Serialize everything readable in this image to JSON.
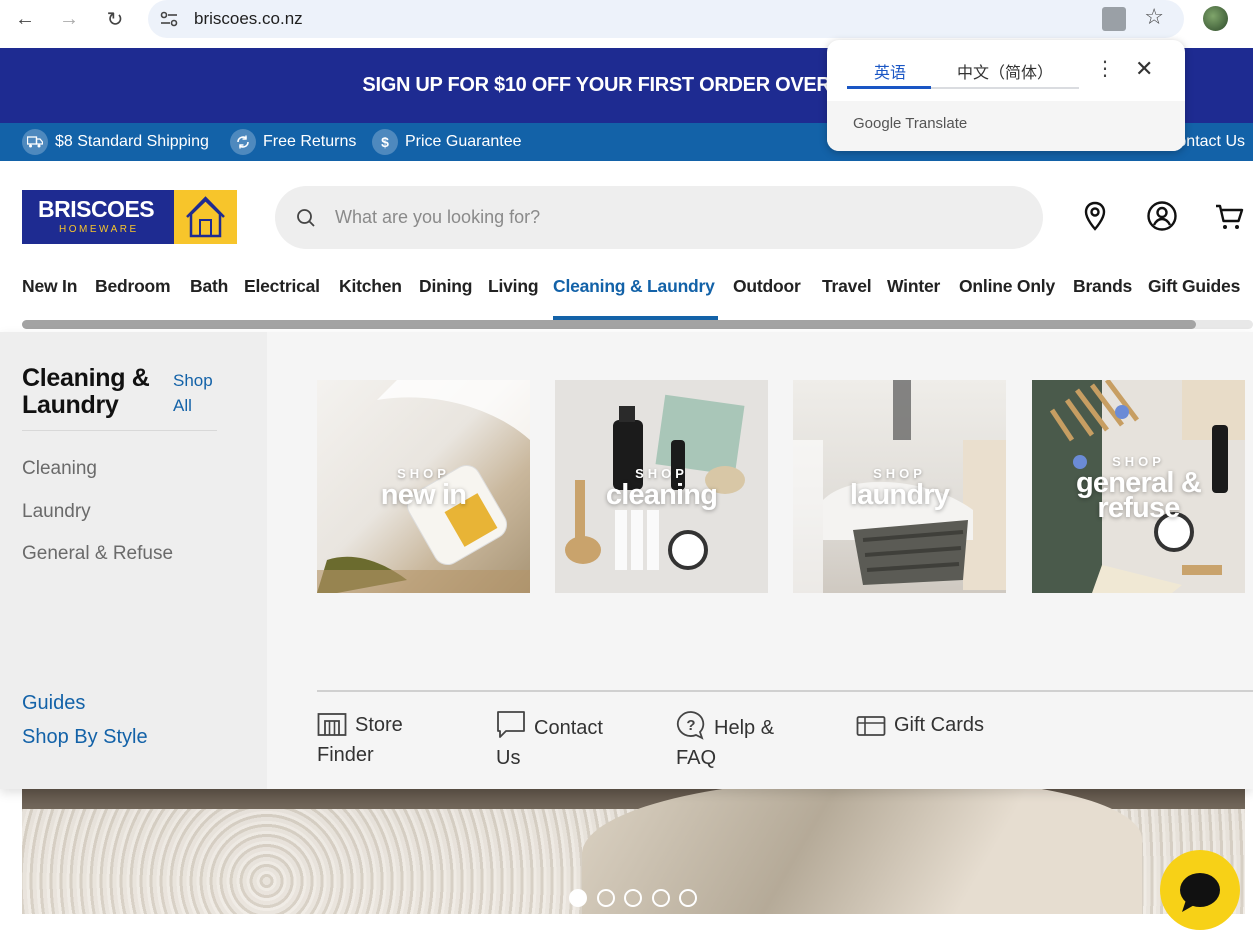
{
  "browser": {
    "url": "briscoes.co.nz"
  },
  "translate_popup": {
    "tab_source": "英语",
    "tab_target": "中文（简体）",
    "more_label": "⋮",
    "close_label": "✕",
    "brand": "Google Translate"
  },
  "promo": {
    "text": "SIGN UP FOR $10 OFF YOUR FIRST ORDER OVER"
  },
  "usp": {
    "shipping": "$8 Standard Shipping",
    "returns": "Free Returns",
    "guarantee": "Price Guarantee",
    "contact": "ontact Us",
    "guarantee_icon_glyph": "$"
  },
  "logo": {
    "word": "BRISCOES",
    "sub": "HOMEWARE"
  },
  "search": {
    "placeholder": "What are you looking for?",
    "value": ""
  },
  "nav": {
    "items": [
      {
        "label": "New In"
      },
      {
        "label": "Bedroom"
      },
      {
        "label": "Bath"
      },
      {
        "label": "Electrical"
      },
      {
        "label": "Kitchen"
      },
      {
        "label": "Dining"
      },
      {
        "label": "Living"
      },
      {
        "label": "Cleaning & Laundry"
      },
      {
        "label": "Outdoor"
      },
      {
        "label": "Travel"
      },
      {
        "label": "Winter"
      },
      {
        "label": "Online Only"
      },
      {
        "label": "Brands"
      },
      {
        "label": "Gift Guides"
      }
    ],
    "active_index": 7
  },
  "mega": {
    "title": "Cleaning & Laundry",
    "shop_all": "Shop All",
    "subcategories": [
      "Cleaning",
      "Laundry",
      "General & Refuse"
    ],
    "bottom_links": [
      "Guides",
      "Shop By Style"
    ],
    "tiles": [
      {
        "shop": "SHOP",
        "name": "new in"
      },
      {
        "shop": "SHOP",
        "name": "cleaning"
      },
      {
        "shop": "SHOP",
        "name": "laundry"
      },
      {
        "shop": "SHOP",
        "name": "general & refuse"
      }
    ],
    "utility": {
      "store_finder": "Store Finder",
      "contact": "Contact Us",
      "help": "Help & FAQ",
      "gift_cards": "Gift Cards"
    }
  },
  "carousel": {
    "slide_count": 5,
    "active_slide": 1
  },
  "colors": {
    "brand_navy": "#1e2b91",
    "brand_blue": "#1362a8",
    "brand_yellow": "#f7c52b",
    "chat_yellow": "#f7d117"
  }
}
